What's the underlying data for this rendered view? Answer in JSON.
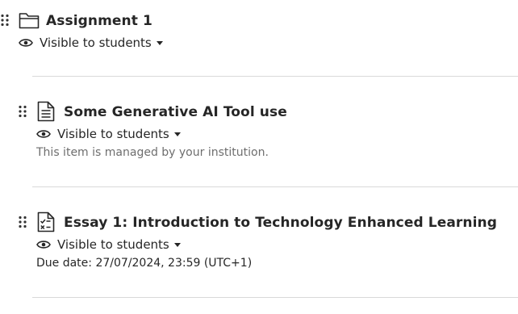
{
  "items": [
    {
      "title": "Assignment 1",
      "visibility": "Visible to students",
      "icon": "folder-icon"
    },
    {
      "title": "Some Generative AI Tool use",
      "visibility": "Visible to students",
      "note": "This item is managed by your institution.",
      "icon": "document-icon"
    },
    {
      "title": "Essay 1: Introduction to Technology Enhanced Learning",
      "visibility": "Visible to students",
      "due": "Due date: 27/07/2024, 23:59 (UTC+1)",
      "icon": "assignment-icon"
    }
  ],
  "colors": {
    "text": "#262626",
    "muted": "#6e6e6e",
    "divider": "#d9d9d9"
  }
}
